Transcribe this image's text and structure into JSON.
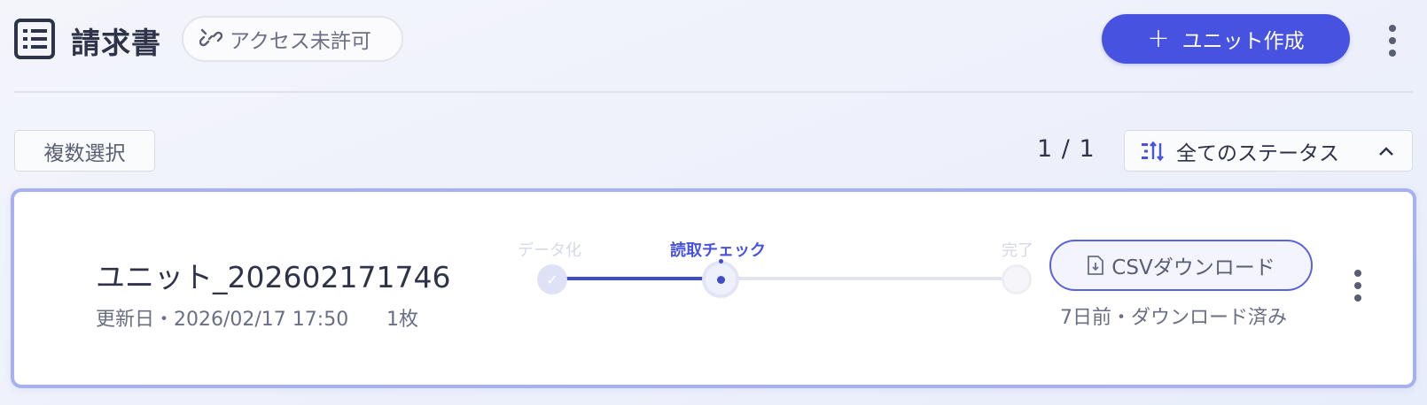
{
  "header": {
    "title": "請求書",
    "access_badge": "アクセス未許可",
    "create_button": "ユニット作成"
  },
  "toolbar": {
    "multi_select": "複数選択",
    "pager": "1 / 1",
    "status_filter": "全てのステータス"
  },
  "unit": {
    "name": "ユニット_202602171746",
    "updated": "更新日・2026/02/17 17:50",
    "count": "1枚",
    "steps": [
      {
        "label": "データ化",
        "state": "done"
      },
      {
        "label": "読取チェック",
        "state": "active"
      },
      {
        "label": "完了",
        "state": "future"
      }
    ],
    "csv_button": "CSVダウンロード",
    "csv_note": "7日前・ダウンロード済み"
  },
  "icons": {
    "title": "list-document-icon",
    "access": "link-broken-icon",
    "create": "plus-icon",
    "filter": "sort-icon",
    "chevron": "chevron-up-icon",
    "csv": "file-download-icon",
    "more": "more-vertical-icon"
  },
  "colors": {
    "accent": "#4752e0",
    "card_border": "#a6b0f2"
  }
}
